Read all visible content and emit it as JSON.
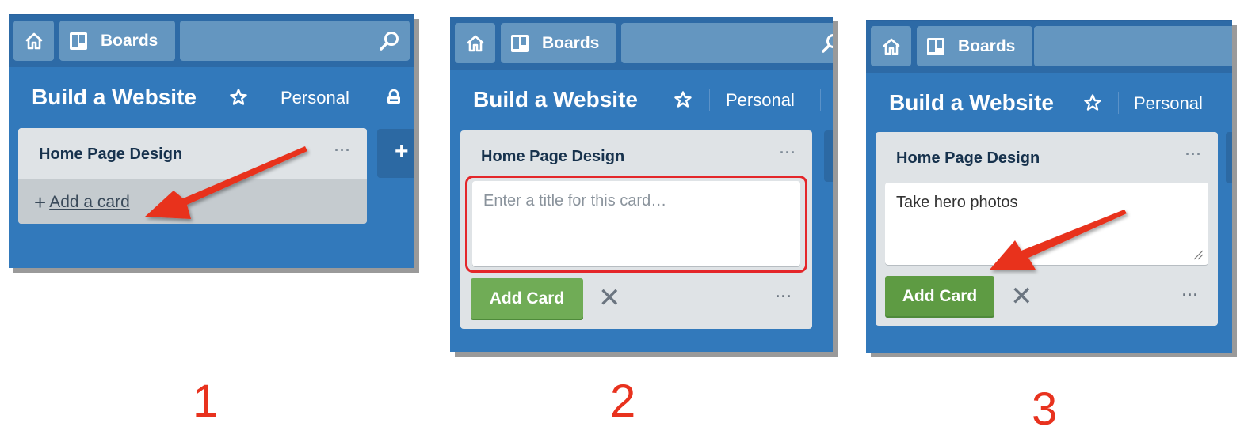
{
  "colors": {
    "board_bg": "#3279bb",
    "header_bg": "#2d6aa6",
    "list_bg": "#dfe3e6",
    "add_card_green": "#70ac56",
    "annotation_red": "#e8321e"
  },
  "panels": [
    {
      "step": "1",
      "header": {
        "home_icon": "home-icon",
        "boards_label": "Boards",
        "boards_icon": "boards-icon",
        "search_icon": "search-icon"
      },
      "board": {
        "title": "Build a Website",
        "star_icon": "star-icon",
        "visibility_label": "Personal",
        "lock_icon": "lock-icon"
      },
      "list": {
        "title": "Home Page Design",
        "menu_label": "···",
        "add_card_prefix": "+",
        "add_card_label": "Add a card"
      },
      "add_list_label": "+"
    },
    {
      "step": "2",
      "header": {
        "home_icon": "home-icon",
        "boards_label": "Boards",
        "boards_icon": "boards-icon",
        "search_icon": "search-icon"
      },
      "board": {
        "title": "Build a Website",
        "star_icon": "star-icon",
        "visibility_label": "Personal"
      },
      "list": {
        "title": "Home Page Design",
        "menu_label": "···"
      },
      "composer": {
        "placeholder": "Enter a title for this card…",
        "value": "",
        "add_button": "Add Card",
        "close_label": "✕",
        "menu_label": "···"
      }
    },
    {
      "step": "3",
      "header": {
        "home_icon": "home-icon",
        "boards_label": "Boards",
        "boards_icon": "boards-icon"
      },
      "board": {
        "title": "Build a Website",
        "star_icon": "star-icon",
        "visibility_label": "Personal"
      },
      "list": {
        "title": "Home Page Design",
        "menu_label": "···"
      },
      "composer": {
        "value": "Take hero photos",
        "add_button": "Add Card",
        "close_label": "✕",
        "menu_label": "···"
      }
    }
  ]
}
